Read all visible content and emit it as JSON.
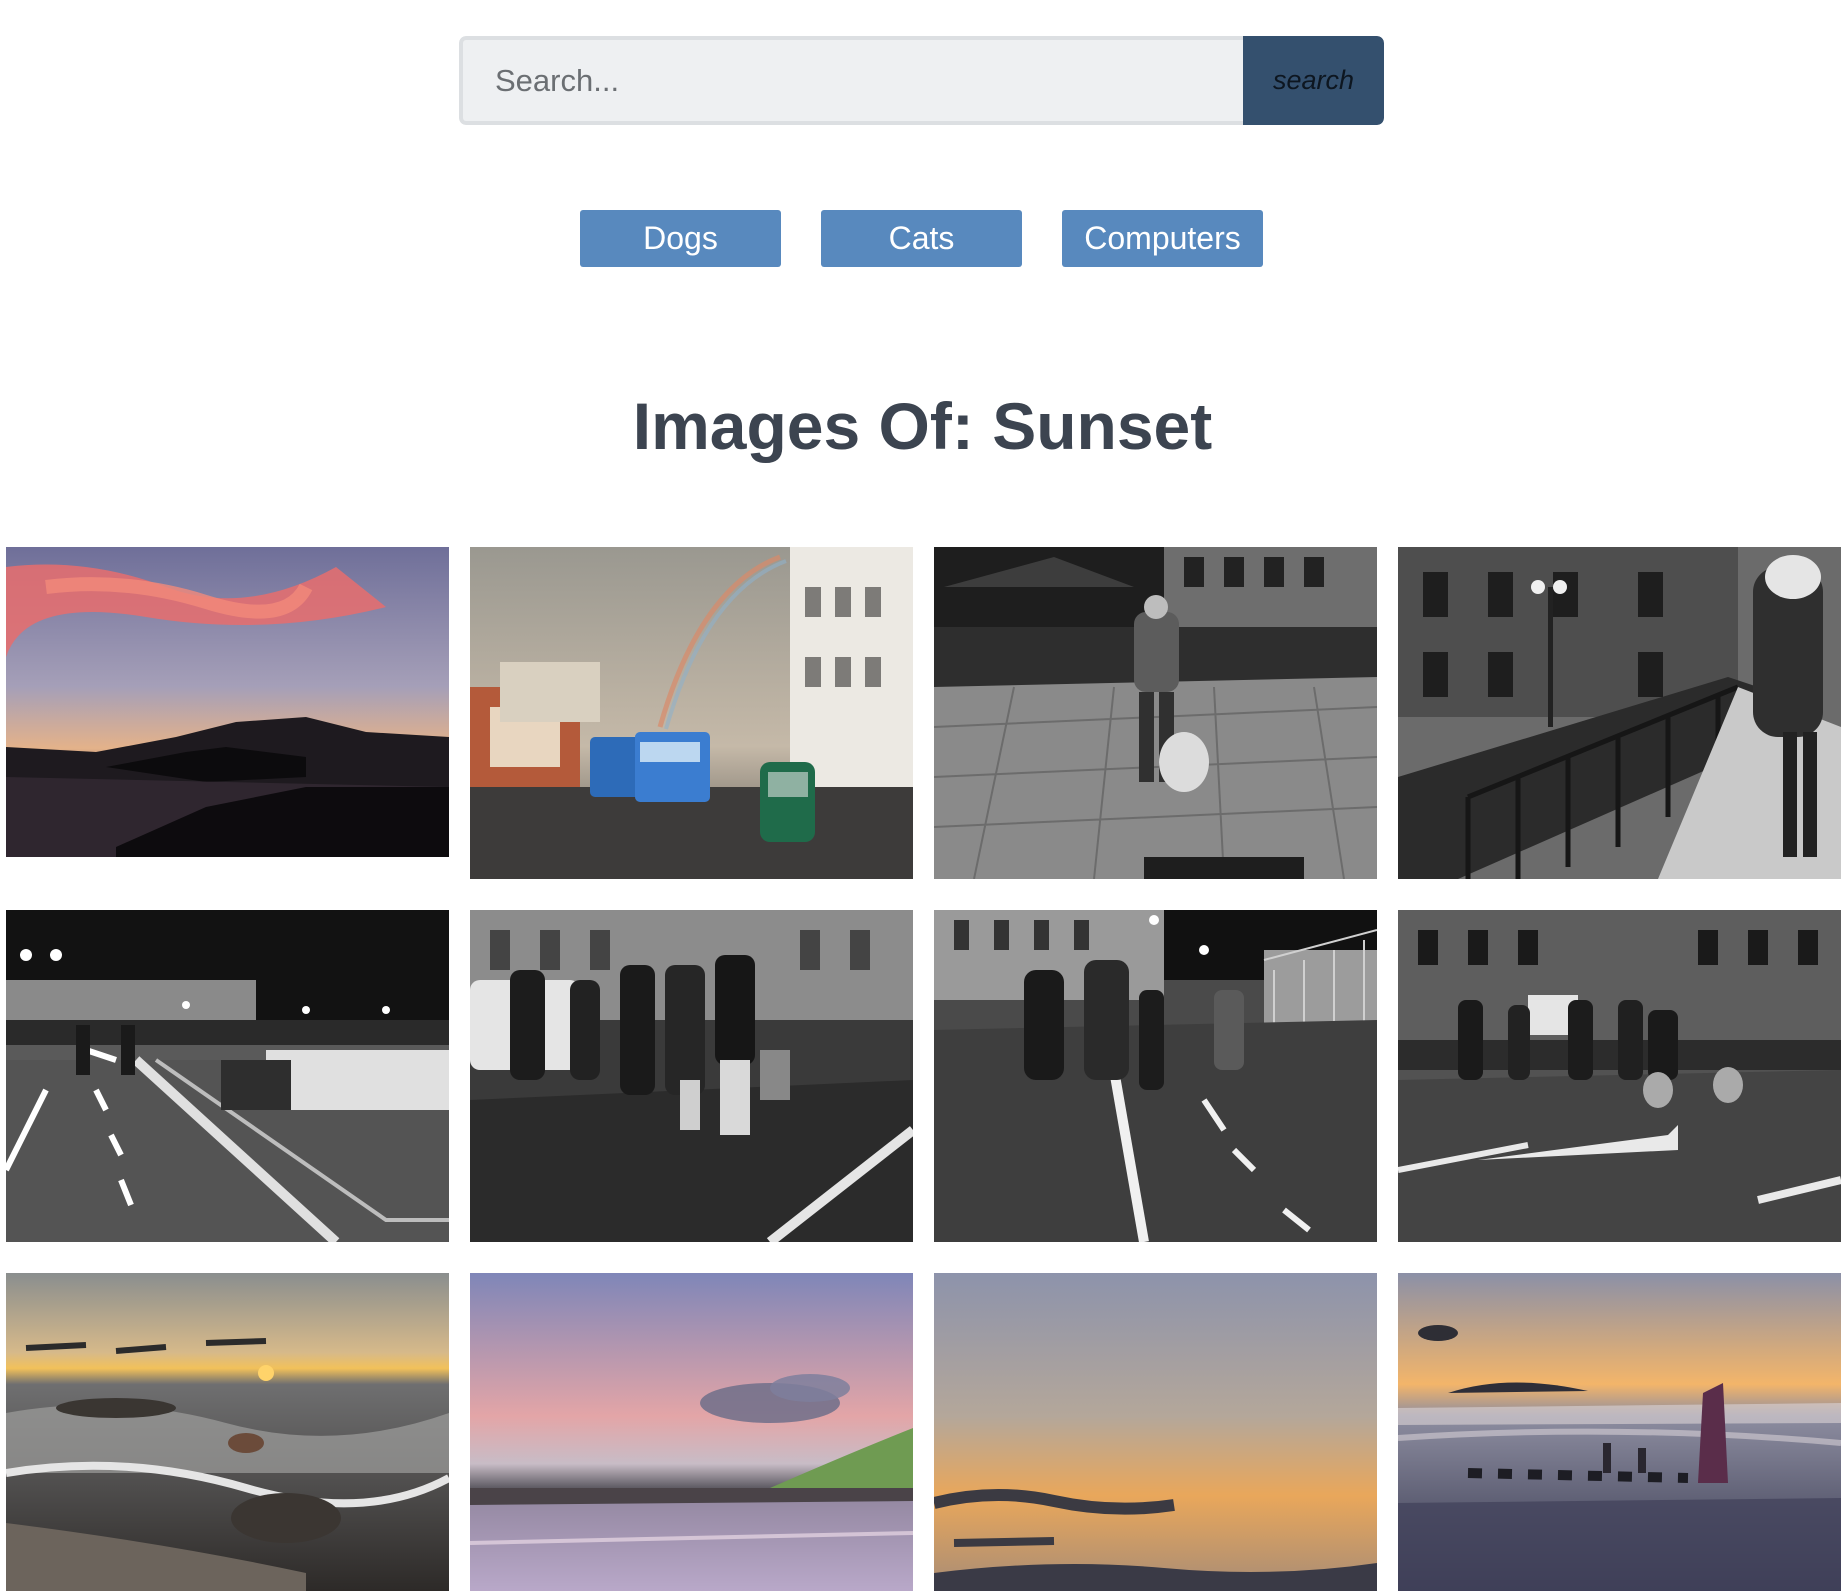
{
  "search": {
    "placeholder": "Search...",
    "value": "",
    "button_label": "search"
  },
  "categories": [
    {
      "label": "Dogs"
    },
    {
      "label": "Cats"
    },
    {
      "label": "Computers"
    }
  ],
  "heading": "Images Of: Sunset",
  "gallery": [
    {
      "scene": "sunset-over-sea-mountains-photo"
    },
    {
      "scene": "street-buses-rainbow-photo"
    },
    {
      "scene": "night-cafe-square-bw-photo"
    },
    {
      "scene": "canal-bridge-woman-bw-photo"
    },
    {
      "scene": "night-promenade-bike-lane-bw-photo"
    },
    {
      "scene": "people-crossing-street-bw-photo"
    },
    {
      "scene": "pedestrians-bike-path-bw-photo"
    },
    {
      "scene": "city-street-arrow-bw-photo"
    },
    {
      "scene": "sunset-rocky-shore-waves-photo"
    },
    {
      "scene": "pink-sky-beach-hill-photo"
    },
    {
      "scene": "orange-sky-clouds-photo"
    },
    {
      "scene": "shipwreck-sunset-beach-photo"
    }
  ]
}
